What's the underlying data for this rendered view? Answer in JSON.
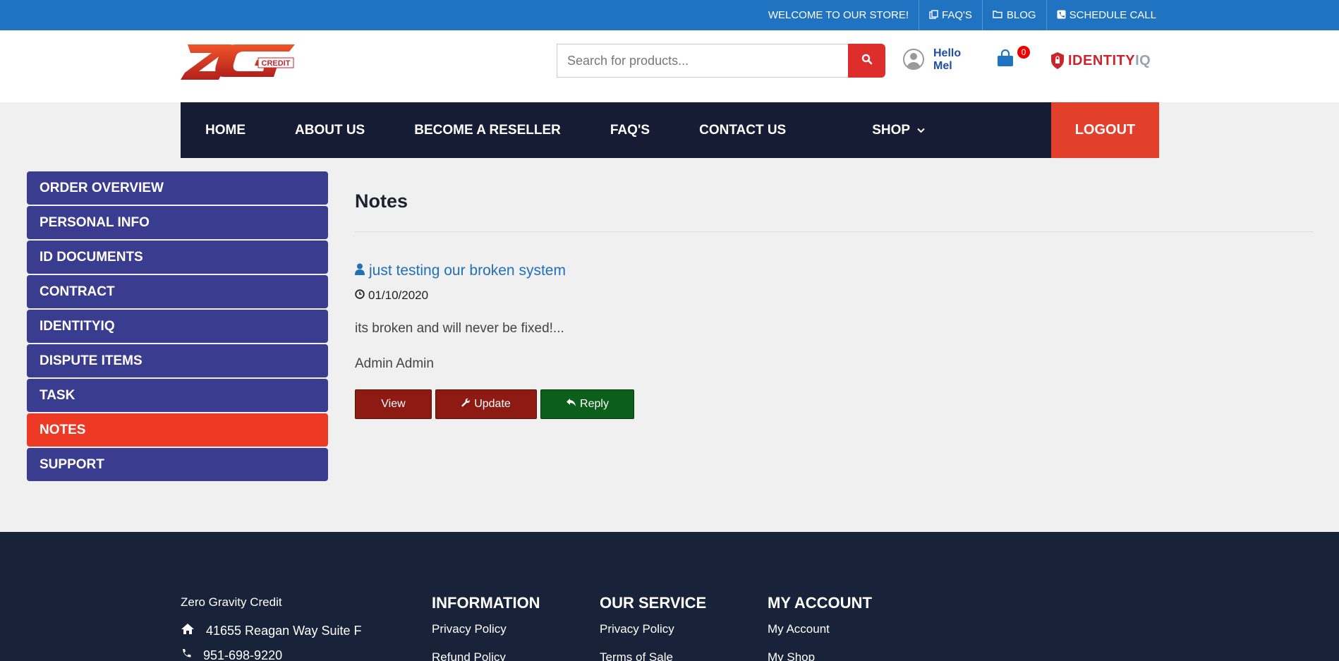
{
  "topbar": {
    "welcome": "WELCOME TO OUR STORE!",
    "faqs": "FAQ'S",
    "blog": "BLOG",
    "schedule": "SCHEDULE CALL"
  },
  "header": {
    "logo_text": "ZG",
    "logo_sub": "CREDIT",
    "search_placeholder": "Search for products...",
    "hello_line1": "Hello",
    "hello_line2": "Mel",
    "cart_count": "0",
    "partner_a": "IDENTITY",
    "partner_b": "IQ"
  },
  "nav": {
    "items": [
      "HOME",
      "ABOUT US",
      "BECOME A RESELLER",
      "FAQ'S",
      "CONTACT US"
    ],
    "shop": "SHOP",
    "logout": "LOGOUT"
  },
  "sidebar": {
    "items": [
      "ORDER OVERVIEW",
      "PERSONAL INFO",
      "ID DOCUMENTS",
      "CONTRACT",
      "IDENTITYIQ",
      "DISPUTE ITEMS",
      "TASK",
      "NOTES",
      "SUPPORT"
    ],
    "active": "NOTES"
  },
  "main": {
    "title": "Notes",
    "note": {
      "title": "just testing our broken system",
      "date": "01/10/2020",
      "body": "its broken and will never be fixed!...",
      "author": "Admin Admin"
    },
    "buttons": {
      "view": "View",
      "update": "Update",
      "reply": "Reply"
    }
  },
  "footer": {
    "brand": "Zero Gravity Credit",
    "address": "41655 Reagan Way Suite F",
    "phone": "951-698-9220",
    "cols": [
      {
        "title": "INFORMATION",
        "links": [
          "Privacy Policy",
          "Refund Policy"
        ]
      },
      {
        "title": "OUR SERVICE",
        "links": [
          "Privacy Policy",
          "Terms of Sale"
        ]
      },
      {
        "title": "MY ACCOUNT",
        "links": [
          "My Account",
          "My Shop"
        ]
      }
    ]
  },
  "colors": {
    "topbar": "#1f73c1",
    "nav": "#161c33",
    "sidebar": "#3a3d8f",
    "active": "#ee3a25",
    "logout": "#e3402b",
    "footer": "#18233a"
  }
}
